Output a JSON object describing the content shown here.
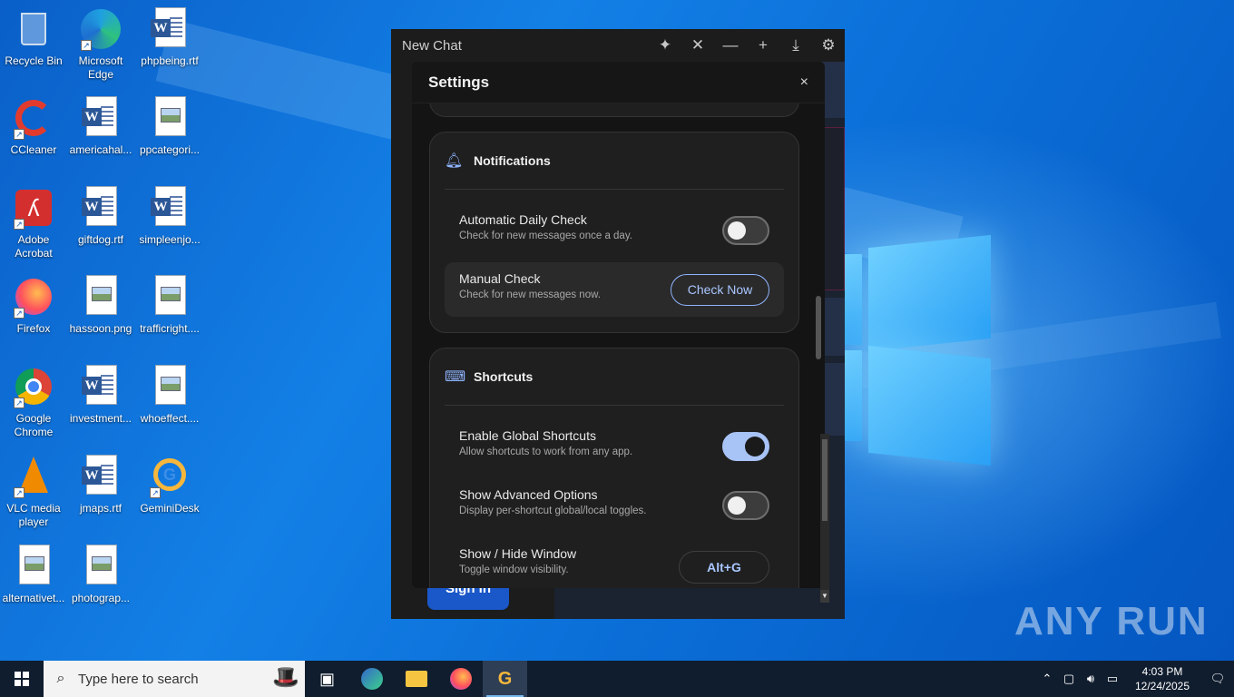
{
  "desktop": {
    "icons": [
      {
        "label": "Recycle Bin",
        "icon": "recycle-bin-icon"
      },
      {
        "label": "Microsoft Edge",
        "icon": "edge-icon"
      },
      {
        "label": "phpbeing.rtf",
        "icon": "word-doc-icon"
      },
      {
        "label": "CCleaner",
        "icon": "ccleaner-icon"
      },
      {
        "label": "americahal...",
        "icon": "word-doc-icon"
      },
      {
        "label": "ppcategori...",
        "icon": "image-file-icon"
      },
      {
        "label": "Adobe Acrobat",
        "icon": "acrobat-icon"
      },
      {
        "label": "giftdog.rtf",
        "icon": "word-doc-icon"
      },
      {
        "label": "simpleenjo...",
        "icon": "word-doc-icon"
      },
      {
        "label": "Firefox",
        "icon": "firefox-icon"
      },
      {
        "label": "hassoon.png",
        "icon": "image-file-icon"
      },
      {
        "label": "trafficright....",
        "icon": "image-file-icon"
      },
      {
        "label": "Google Chrome",
        "icon": "chrome-icon"
      },
      {
        "label": "investment...",
        "icon": "word-doc-icon"
      },
      {
        "label": "whoeffect....",
        "icon": "image-file-icon"
      },
      {
        "label": "VLC media player",
        "icon": "vlc-icon"
      },
      {
        "label": "jmaps.rtf",
        "icon": "word-doc-icon"
      },
      {
        "label": "GeminiDesk",
        "icon": "geminidesk-icon"
      },
      {
        "label": "alternativet...",
        "icon": "image-file-icon"
      },
      {
        "label": "photograp...",
        "icon": "image-file-icon"
      }
    ]
  },
  "app": {
    "title": "New Chat",
    "titlebar_icons": [
      "sparkle-icon",
      "close-icon",
      "minimize-icon",
      "plus-icon",
      "download-icon",
      "gear-icon"
    ],
    "background_button": "Sign in",
    "settings": {
      "title": "Settings",
      "close_glyph": "×",
      "notifications": {
        "heading": "Notifications",
        "auto_check": {
          "title": "Automatic Daily Check",
          "desc": "Check for new messages once a day.",
          "enabled": false
        },
        "manual_check": {
          "title": "Manual Check",
          "desc": "Check for new messages now.",
          "button": "Check Now"
        }
      },
      "shortcuts": {
        "heading": "Shortcuts",
        "global": {
          "title": "Enable Global Shortcuts",
          "desc": "Allow shortcuts to work from any app.",
          "enabled": true
        },
        "advanced": {
          "title": "Show Advanced Options",
          "desc": "Display per-shortcut global/local toggles.",
          "enabled": false
        },
        "show_hide": {
          "title": "Show / Hide Window",
          "desc": "Toggle window visibility.",
          "key": "Alt+G"
        }
      }
    }
  },
  "taskbar": {
    "search_placeholder": "Type here to search",
    "apps": [
      "task-view-icon",
      "edge-icon",
      "file-explorer-icon",
      "firefox-icon",
      "geminidesk-icon"
    ],
    "time": "4:03 PM",
    "date": "12/24/2025"
  },
  "watermark": "ANY RUN",
  "colors": {
    "accent": "#a8c3f5",
    "link": "#8fb4ff",
    "taskbar": "#101d2e",
    "modal": "#141414"
  }
}
